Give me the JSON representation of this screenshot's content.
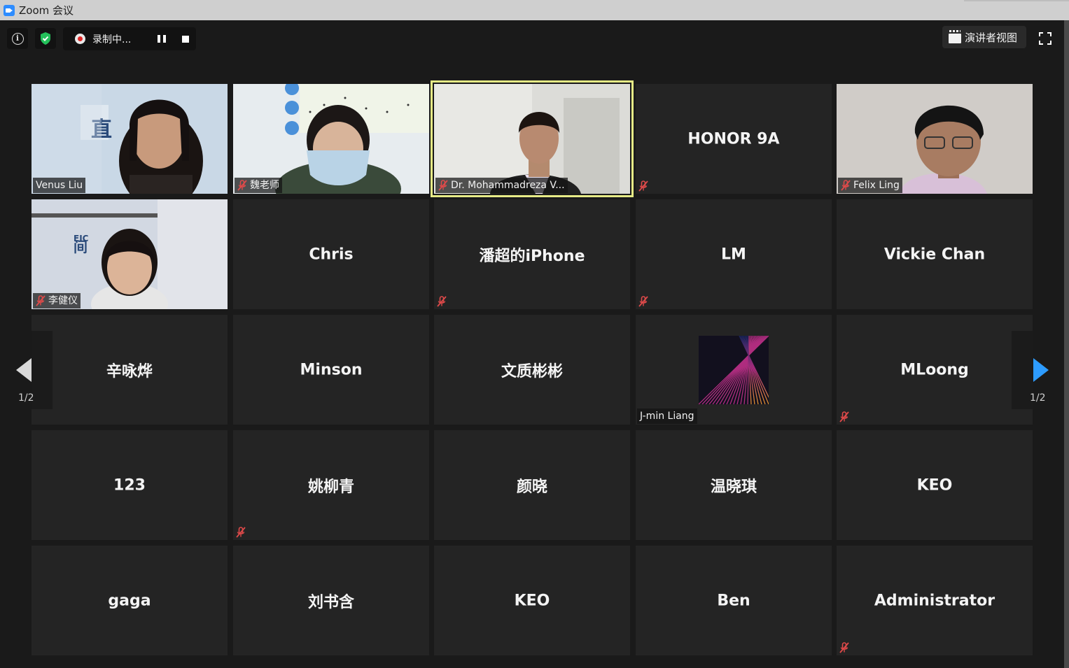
{
  "window": {
    "title": "Zoom 会议"
  },
  "toolbar": {
    "recording_label": "录制中...",
    "speaker_view_label": "演讲者视图"
  },
  "pagination": {
    "left": "1/2",
    "right": "1/2"
  },
  "colors": {
    "accent": "#2d9cff",
    "active_speaker": "#e6ea86",
    "mute": "#e04a4a",
    "shield": "#23c05a"
  },
  "tiles": [
    {
      "name": "Venus Liu",
      "video": true,
      "muted": false
    },
    {
      "name": "魏老师",
      "video": true,
      "muted": true
    },
    {
      "name": "Dr. Mohammadreza V...",
      "video": true,
      "muted": true,
      "active": true
    },
    {
      "name": "HONOR 9A",
      "video": false,
      "muted": true
    },
    {
      "name": "Felix Ling",
      "video": true,
      "muted": true
    },
    {
      "name": "李健仪",
      "video": true,
      "muted": true
    },
    {
      "name": "Chris",
      "video": false,
      "muted": false
    },
    {
      "name": "潘超的iPhone",
      "video": false,
      "muted": true
    },
    {
      "name": "LM",
      "video": false,
      "muted": true
    },
    {
      "name": "Vickie Chan",
      "video": false,
      "muted": false
    },
    {
      "name": "辛咏烨",
      "video": false,
      "muted": false
    },
    {
      "name": "Minson",
      "video": false,
      "muted": false
    },
    {
      "name": "文质彬彬",
      "video": false,
      "muted": false
    },
    {
      "name": "J-min Liang",
      "video": false,
      "muted": false,
      "avatar": true
    },
    {
      "name": "MLoong",
      "video": false,
      "muted": true
    },
    {
      "name": "123",
      "video": false,
      "muted": false
    },
    {
      "name": "姚柳青",
      "video": false,
      "muted": true
    },
    {
      "name": "颜晓",
      "video": false,
      "muted": false
    },
    {
      "name": "温晓琪",
      "video": false,
      "muted": false
    },
    {
      "name": "KEO",
      "video": false,
      "muted": false
    },
    {
      "name": "gaga",
      "video": false,
      "muted": false
    },
    {
      "name": "刘书含",
      "video": false,
      "muted": false
    },
    {
      "name": "KEO",
      "video": false,
      "muted": false
    },
    {
      "name": "Ben",
      "video": false,
      "muted": false
    },
    {
      "name": "Administrator",
      "video": false,
      "muted": true
    }
  ]
}
